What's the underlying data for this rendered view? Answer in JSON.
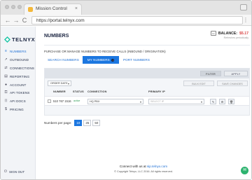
{
  "browser": {
    "tab_title": "Mission Control",
    "tab_close": "×",
    "url": "https://portal.telnyx.com",
    "back": "←",
    "forward": "→",
    "reload": "C",
    "menu": "⋮"
  },
  "sidebar": {
    "logo": "TELNYX",
    "items": [
      {
        "label": "NUMBERS",
        "icon": "≡",
        "active": true
      },
      {
        "label": "OUTBOUND",
        "icon": "↗"
      },
      {
        "label": "CONNECTIONS",
        "icon": "⇄"
      },
      {
        "label": "REPORTING",
        "icon": "▤"
      },
      {
        "label": "ACCOUNT",
        "icon": "●"
      },
      {
        "label": "API TOKENS",
        "icon": "⚿"
      },
      {
        "label": "API DOCS",
        "icon": "⟨⟩"
      },
      {
        "label": "PRICING",
        "icon": "$"
      }
    ],
    "signout": "SIGN OUT",
    "signout_icon": "⏻"
  },
  "header": {
    "title": "NUMBERS",
    "balance_label": "BALANCE:",
    "balance_value": "$5.17",
    "balance_sub": "Refreshes periodically",
    "balance_icon": "▭"
  },
  "main": {
    "subtitle": "PURCHASE OR MANAGE NUMBERS TO RECEIVE CALLS (INBOUND / ORIGINATION)",
    "tabs": [
      {
        "label": "SEARCH NUMBERS"
      },
      {
        "label": "MY NUMBERS",
        "badge": "i"
      },
      {
        "label": "PORT NUMBERS"
      }
    ],
    "filter_label": "FILTER",
    "apply_label": "APPLY",
    "order_date": "ORDER DATE",
    "order_caret": "▾",
    "bulk_edit": "BULK EDIT",
    "save_changes": "SAVE CHANGES",
    "columns": {
      "number": "NUMBER",
      "status": "STATUS",
      "connection": "CONNECTION",
      "primary_ip": "PRIMARY IP"
    },
    "row": {
      "number": "510 767 1516",
      "status": "active",
      "connection": "HQ PBX",
      "primary_ip_placeholder": "SELECT IP",
      "btn_edit": "✎",
      "btn_settings": "⚙",
      "btn_delete": "🗑"
    },
    "per_page_label": "Numbers per page:",
    "per_page_options": [
      "10",
      "25",
      "50"
    ],
    "per_page_selected": "10"
  },
  "footer": {
    "connect_prefix": "Connect with us at",
    "connect_site": "sip.telnyx.com",
    "copyright": "© Copyright Telnyx, LLC 2016. All rights reserved."
  },
  "chat_icon": "✉",
  "colors": {
    "accent": "#1c77e0",
    "brand_dark": "#1a2440",
    "balance": "#d94545",
    "status_active": "#2e9b54",
    "chat": "#2db36f"
  }
}
